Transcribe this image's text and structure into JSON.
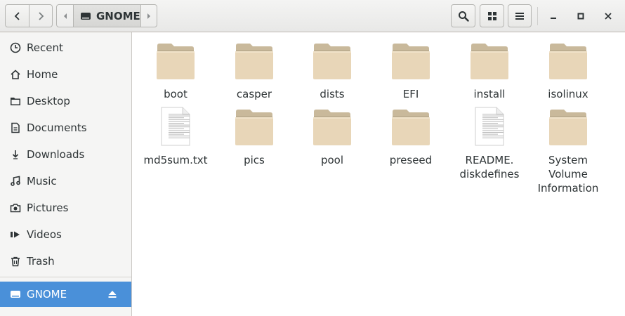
{
  "header": {
    "location_label": "GNOME"
  },
  "sidebar": {
    "items": [
      {
        "label": "Recent",
        "icon": "clock-icon"
      },
      {
        "label": "Home",
        "icon": "home-icon"
      },
      {
        "label": "Desktop",
        "icon": "folder-icon"
      },
      {
        "label": "Documents",
        "icon": "document-icon"
      },
      {
        "label": "Downloads",
        "icon": "download-icon"
      },
      {
        "label": "Music",
        "icon": "music-icon"
      },
      {
        "label": "Pictures",
        "icon": "camera-icon"
      },
      {
        "label": "Videos",
        "icon": "video-icon"
      },
      {
        "label": "Trash",
        "icon": "trash-icon"
      }
    ],
    "device": {
      "label": "GNOME",
      "icon": "drive-icon"
    }
  },
  "files": [
    {
      "name": "boot",
      "kind": "folder"
    },
    {
      "name": "casper",
      "kind": "folder"
    },
    {
      "name": "dists",
      "kind": "folder"
    },
    {
      "name": "EFI",
      "kind": "folder"
    },
    {
      "name": "install",
      "kind": "folder"
    },
    {
      "name": "isolinux",
      "kind": "folder"
    },
    {
      "name": "md5sum.txt",
      "kind": "text"
    },
    {
      "name": "pics",
      "kind": "folder"
    },
    {
      "name": "pool",
      "kind": "folder"
    },
    {
      "name": "preseed",
      "kind": "folder"
    },
    {
      "name": "README.\ndiskdefines",
      "kind": "text"
    },
    {
      "name": "System\nVolume\nInformation",
      "kind": "folder"
    }
  ],
  "colors": {
    "selection": "#4a90d9",
    "folder": "#e8d6b8",
    "folder_tab": "#c9b99b"
  }
}
